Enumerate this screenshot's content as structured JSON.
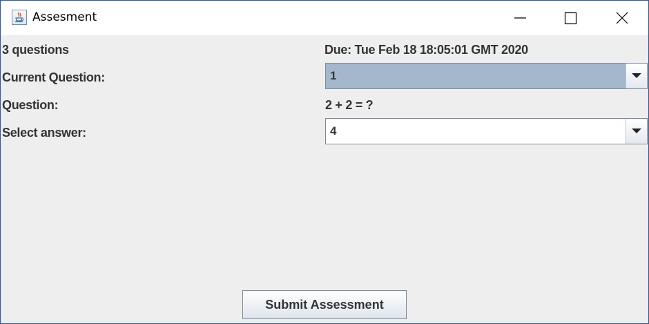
{
  "window": {
    "title": "Assesment",
    "icon": "java-cup-icon",
    "controls": [
      "minimize-icon",
      "maximize-icon",
      "close-icon"
    ]
  },
  "header": {
    "question_count": "3 questions",
    "due": "Due: Tue Feb 18 18:05:01 GMT 2020"
  },
  "form": {
    "current_question_label": "Current Question:",
    "current_question_value": "1",
    "question_label": "Question:",
    "question_text": "2 + 2 = ?",
    "answer_label": "Select answer:",
    "answer_value": "4"
  },
  "actions": {
    "submit_label": "Submit Assessment"
  },
  "colors": {
    "title_bar": "#ffffff",
    "window_border": "#2b579a",
    "panel_bg": "#eeeeee",
    "selected_combo_bg": "#a3b8cc",
    "combo_bg": "#ffffff",
    "label_text": "#333333"
  }
}
